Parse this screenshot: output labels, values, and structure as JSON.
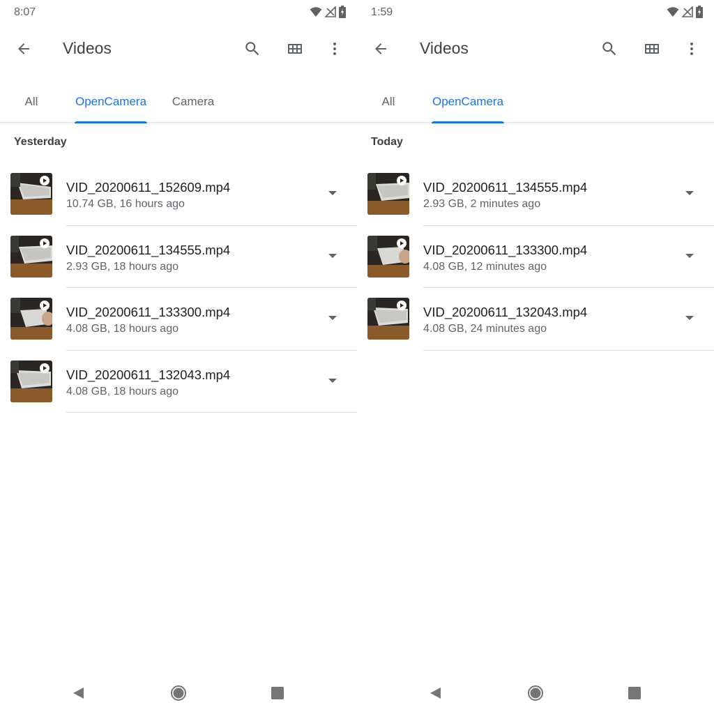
{
  "colors": {
    "accent": "#1a73e8",
    "text_primary": "#202124",
    "text_secondary": "#5f6368",
    "divider": "#dadce0"
  },
  "screens": [
    {
      "status": {
        "time": "8:07"
      },
      "app_bar": {
        "title": "Videos",
        "icons": [
          "back-arrow-icon",
          "search-icon",
          "grid-view-icon",
          "more-vert-icon"
        ]
      },
      "tabs": [
        {
          "label": "All",
          "active": false
        },
        {
          "label": "OpenCamera",
          "active": true
        },
        {
          "label": "Camera",
          "active": false
        }
      ],
      "section": "Yesterday",
      "files": [
        {
          "name": "VID_20200611_152609.mp4",
          "meta": "10.74 GB, 16 hours ago"
        },
        {
          "name": "VID_20200611_134555.mp4",
          "meta": "2.93 GB, 18 hours ago"
        },
        {
          "name": "VID_20200611_133300.mp4",
          "meta": "4.08 GB, 18 hours ago"
        },
        {
          "name": "VID_20200611_132043.mp4",
          "meta": "4.08 GB, 18 hours ago"
        }
      ]
    },
    {
      "status": {
        "time": "1:59"
      },
      "app_bar": {
        "title": "Videos",
        "icons": [
          "back-arrow-icon",
          "search-icon",
          "grid-view-icon",
          "more-vert-icon"
        ]
      },
      "tabs": [
        {
          "label": "All",
          "active": false
        },
        {
          "label": "OpenCamera",
          "active": true
        }
      ],
      "section": "Today",
      "files": [
        {
          "name": "VID_20200611_134555.mp4",
          "meta": "2.93 GB, 2 minutes ago"
        },
        {
          "name": "VID_20200611_133300.mp4",
          "meta": "4.08 GB, 12 minutes ago"
        },
        {
          "name": "VID_20200611_132043.mp4",
          "meta": "4.08 GB, 24 minutes ago"
        }
      ]
    }
  ]
}
